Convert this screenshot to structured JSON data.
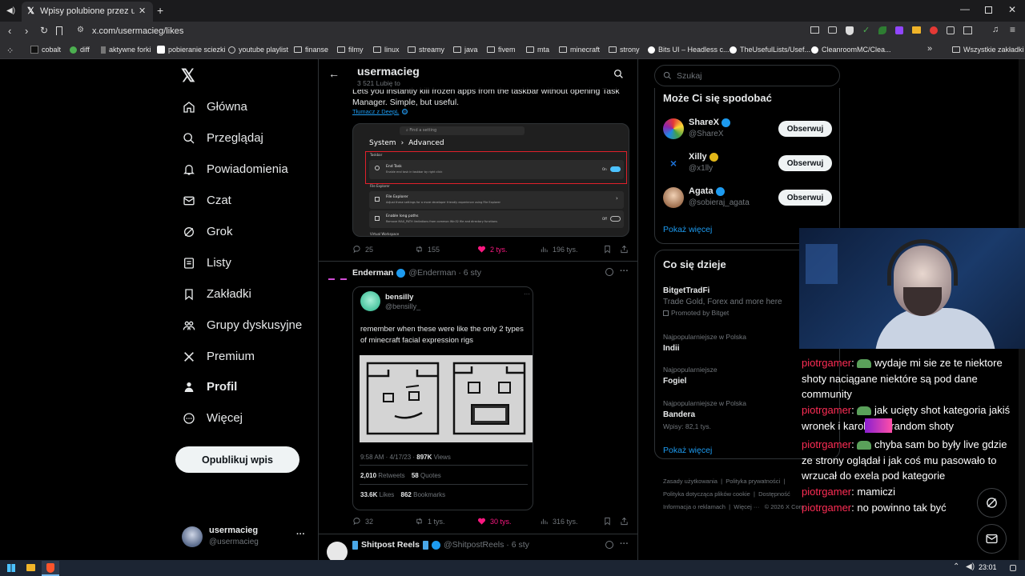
{
  "browser": {
    "tab_title": "Wpisy polubione przez usermacieg",
    "url": "x.com/usermacieg/likes",
    "bookmarks": [
      "cobalt",
      "diff",
      "aktywne forki",
      "pobieranie sciezki",
      "youtube playlist",
      "finanse",
      "filmy",
      "linux",
      "streamy",
      "java",
      "fivem",
      "mta",
      "minecraft",
      "strony",
      "Bits UI – Headless c...",
      "TheUsefulLists/Usef...",
      "CleanroomMC/Clea..."
    ],
    "all_bookmarks": "Wszystkie zakładki"
  },
  "nav": {
    "items": [
      "Główna",
      "Przeglądaj",
      "Powiadomienia",
      "Czat",
      "Grok",
      "Listy",
      "Zakładki",
      "Grupy dyskusyjne",
      "Premium",
      "Profil",
      "Więcej"
    ],
    "icons": [
      "home-icon",
      "search-icon",
      "bell-icon",
      "mail-icon",
      "grok-icon",
      "list-icon",
      "bookmark-icon",
      "community-icon",
      "x-logo-icon",
      "person-icon",
      "more-circle-icon"
    ],
    "publish": "Opublikuj wpis",
    "account_name": "usermacieg",
    "account_handle": "@usermacieg",
    "account_more": "···"
  },
  "feed": {
    "header_name": "usermacieg",
    "header_sub": "3 521 Lubię to",
    "tweet1": {
      "text_line1": "Lets you instantly kill frozen apps from the taskbar without opening Task",
      "text_line2": "Manager. Simple, but useful.",
      "translate": "Tłumacz z DeepL",
      "settings": {
        "search_placeholder": "Find a setting",
        "crumb_system": "System",
        "crumb_sep": "›",
        "crumb_advanced": "Advanced",
        "section_taskbar": "Taskbar",
        "end_task_title": "End Task",
        "end_task_desc": "Enable end task in taskbar by right click",
        "end_task_state": "On",
        "section_file_explorer": "File Explorer",
        "fe_title": "File Explorer",
        "fe_desc": "Adjust these settings for a more developer friendly experience using File Explorer",
        "long_title": "Enable long paths",
        "long_desc": "Remove MAX_PATH limitations from common Win32 file and directory functions",
        "long_state": "Off",
        "section_virtual": "Virtual Workspace"
      },
      "replies": "25",
      "reposts": "155",
      "likes": "2 tys.",
      "views": "196 tys."
    },
    "tweet2": {
      "name": "Enderman",
      "meta": "@Enderman · 6 sty",
      "quote_name": "bensilly",
      "quote_handle": "@bensilly_",
      "quote_text_line1": "remember when these were like the only 2 types",
      "quote_text_line2": "of minecraft facial expression rigs",
      "time": "9:58 AM · 4/17/23 ·",
      "views_num": "897K",
      "views_label": "Views",
      "retweets_num": "2,010",
      "retweets_label": "Retweets",
      "quotes_num": "58",
      "quotes_label": "Quotes",
      "likes_num": "33.6K",
      "likes_label": "Likes",
      "bookmarks_num": "862",
      "bookmarks_label": "Bookmarks",
      "replies": "32",
      "reposts": "1 tys.",
      "likes": "30 tys.",
      "views": "316 tys."
    },
    "tweet3": {
      "name": "Shitpost Reels",
      "meta": "@ShitpostReels · 6 sty"
    }
  },
  "sidebar": {
    "search_placeholder": "Szukaj",
    "suggest_title": "Może Ci się spodobać",
    "suggestions": [
      {
        "name": "ShareX",
        "handle": "@ShareX",
        "badge": "#1d9bf0"
      },
      {
        "name": "Xilly",
        "handle": "@x1lly",
        "badge": "#e2b719"
      },
      {
        "name": "Agata",
        "handle": "@sobieraj_agata",
        "badge": "#1d9bf0"
      }
    ],
    "follow_label": "Obserwuj",
    "show_more": "Pokaż więcej",
    "trends_title": "Co się dzieje",
    "promo": {
      "title": "BitgetTradFi",
      "desc": "Trade Gold, Forex and more here",
      "promoted": "Promoted by Bitget"
    },
    "trends": [
      {
        "context": "Najpopularniejsze w Polska",
        "topic": "Indii"
      },
      {
        "context": "Najpopularniejsze",
        "topic": "Fogiel"
      },
      {
        "context": "Najpopularniejsze w Polska",
        "topic": "Bandera",
        "posts": "Wpisy: 82,1 tys."
      }
    ],
    "trends_more": "Pokaż więcej",
    "footer": {
      "terms": "Zasady użytkowania",
      "privacy": "Polityka prywatności",
      "cookies": "Polityka dotycząca plików cookie",
      "access": "Dostępność",
      "ads": "Informacja o reklamach",
      "more": "Więcej ···",
      "copy": "© 2026 X Corp."
    }
  },
  "chat": [
    {
      "user": "piotrgamer",
      "text": "wydaje mi sie ze te niektore shoty naciągane niektóre są pod dane community"
    },
    {
      "user": "piotrgamer",
      "text": "jak ucięty shot kategoria jakiś wronek i       karol dwa random shoty"
    },
    {
      "user": "piotrgamer",
      "text": "chyba sam bo były live gdzie ze strony oglądał i jak coś mu pasowało to wrzucał do exela pod kategorie"
    },
    {
      "user": "piotrgamer",
      "text": "mamiczi"
    },
    {
      "user": "piotrgamer",
      "text": "no powinno tak być"
    }
  ],
  "taskbar": {
    "clock": "23:01"
  },
  "colors": {
    "accent": "#1d9bf0",
    "like": "#f91880",
    "chat_user": "#ff2d55"
  }
}
